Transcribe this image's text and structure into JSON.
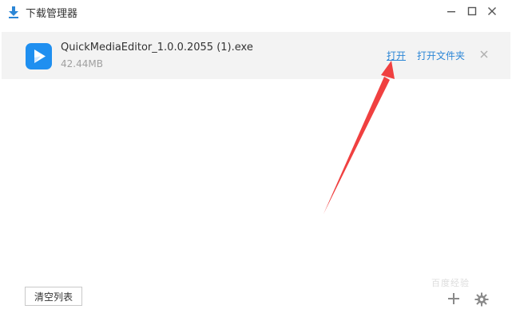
{
  "window": {
    "title": "下载管理器"
  },
  "download": {
    "filename": "QuickMediaEditor_1.0.0.2055 (1).exe",
    "size": "42.44MB",
    "open_label": "打开",
    "open_folder_label": "打开文件夹"
  },
  "footer": {
    "clear_label": "清空列表"
  },
  "watermark": "百度经验",
  "colors": {
    "link": "#2b86d6",
    "row_bg": "#f3f3f3",
    "app_icon": "#1f8ff0",
    "arrow": "#f04040"
  },
  "icons": {
    "title": "download-icon",
    "app": "play-icon",
    "minimize": "minimize-icon",
    "maximize": "maximize-icon",
    "close": "close-icon",
    "remove": "close-icon",
    "add": "plus-icon",
    "settings": "gear-icon"
  }
}
